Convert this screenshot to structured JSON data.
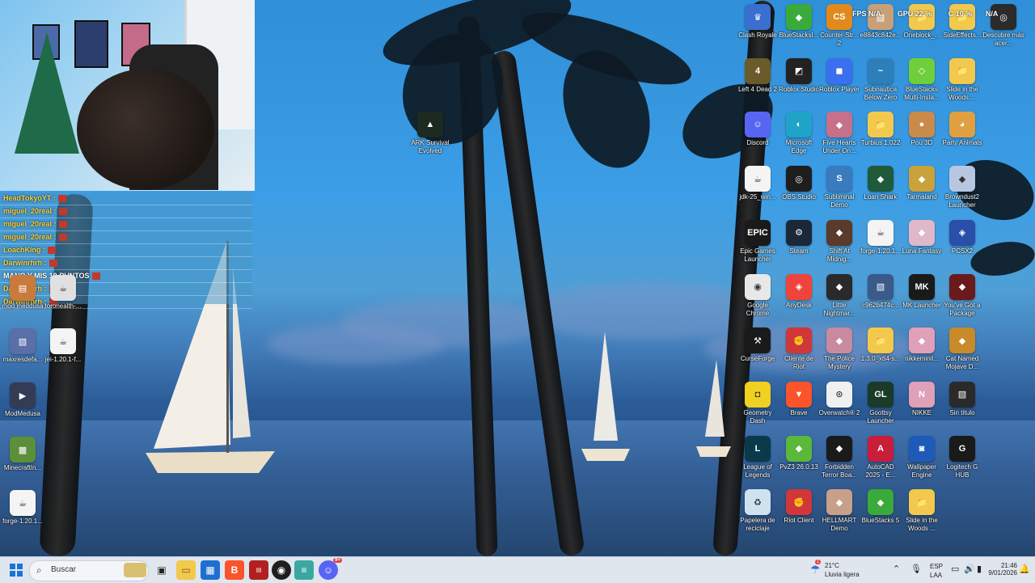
{
  "webcam_chat": {
    "lines": [
      {
        "user": "HeadTokyoYT :",
        "msg": ""
      },
      {
        "user": "miguel_20real :",
        "msg": ""
      },
      {
        "user": "miguel_20real :",
        "msg": ""
      },
      {
        "user": "miguel_20real :",
        "msg": ""
      },
      {
        "user": "LoachKing :",
        "msg": ""
      },
      {
        "user": "Darwinrhrh :",
        "msg": ""
      },
      {
        "user": "",
        "msg": "MANO Y MIS 10 PUNTOS"
      },
      {
        "user": "Darwinrhrh :",
        "msg": ""
      },
      {
        "user": "Darwinrhrh :",
        "msg": ""
      }
    ]
  },
  "desktop": {
    "left_icons": [
      {
        "label": "mod meddusa",
        "icon": "file-icon",
        "color": "#c97b3c"
      },
      {
        "label": "toronealth-...",
        "icon": "java-icon",
        "color": "#e0e0e0"
      },
      {
        "label": "maxresdefa...",
        "icon": "image-icon",
        "color": "#5a6fa8"
      },
      {
        "label": "jei-1.20.1-f...",
        "icon": "java-icon",
        "color": "#f4f4f4"
      },
      {
        "label": "ModMedusa",
        "icon": "video-icon",
        "color": "#333b55"
      },
      {
        "label": "MinecraftIn...",
        "icon": "minecraft-icon",
        "color": "#5b8f3a"
      },
      {
        "label": "forge-1.20.1...",
        "icon": "java-icon",
        "color": "#f4f4f4"
      }
    ],
    "ark_icon": {
      "label": "ARK Survival Evolved",
      "icon": "ark-icon",
      "color": "#1d2a22"
    },
    "grid": [
      [
        {
          "label": "Clash Royale",
          "icon": "clash-royale-icon",
          "color": "#3a6fd0"
        },
        {
          "label": "BlueStacksI...",
          "icon": "bluestacks-icon",
          "color": "#3aaa3a"
        },
        {
          "label": "Counter-Str... 2",
          "icon": "counter-strike-icon",
          "color": "#e08a1e"
        },
        {
          "label": "e8843c842e...",
          "icon": "image-icon",
          "color": "#c7a07a"
        },
        {
          "label": "Oneblock_...",
          "icon": "folder-icon",
          "color": "#f2c94c"
        },
        {
          "label": "SideEffects...",
          "icon": "folder-icon",
          "color": "#f2c94c"
        },
        {
          "label": "Descubre más acer...",
          "icon": "acer-icon",
          "color": "#2b2b2b"
        }
      ],
      [
        {
          "label": "Left 4 Dead 2",
          "icon": "left4dead-icon",
          "color": "#6b5b2a"
        },
        {
          "label": "Roblox Studio",
          "icon": "roblox-studio-icon",
          "color": "#222222"
        },
        {
          "label": "Roblox Player",
          "icon": "roblox-icon",
          "color": "#3a6ff0"
        },
        {
          "label": "Subnautica Below Zero",
          "icon": "subnautica-icon",
          "color": "#2c7fb8"
        },
        {
          "label": "BlueStacks Multi-Insta...",
          "icon": "bluestacks-multi-icon",
          "color": "#6fcf3a"
        },
        {
          "label": "Slide in the Woods ...",
          "icon": "folder-icon",
          "color": "#f2c94c"
        }
      ],
      [
        {
          "label": "Discord",
          "icon": "discord-icon",
          "color": "#5865f2"
        },
        {
          "label": "Microsoft Edge",
          "icon": "edge-icon",
          "color": "#1fa3c7"
        },
        {
          "label": "Five Hearts Under On...",
          "icon": "game-icon",
          "color": "#c7708a"
        },
        {
          "label": "Turbius 1.022",
          "icon": "folder-icon",
          "color": "#f2c94c"
        },
        {
          "label": "Pou 3D",
          "icon": "pou-icon",
          "color": "#c98a4a"
        },
        {
          "label": "Party Animals",
          "icon": "party-animals-icon",
          "color": "#e0a040"
        }
      ],
      [
        {
          "label": "jdk-25_win...",
          "icon": "java-icon",
          "color": "#f4f4f4"
        },
        {
          "label": "OBS Studio",
          "icon": "obs-icon",
          "color": "#1e1e1e"
        },
        {
          "label": "Subliminal Demo",
          "icon": "subliminal-icon",
          "color": "#3a7abf"
        },
        {
          "label": "Loan Shark",
          "icon": "game-icon",
          "color": "#1f5a3a"
        },
        {
          "label": "Tarmaland",
          "icon": "game-icon",
          "color": "#c9a23a"
        },
        {
          "label": "Browndust2 Launcher",
          "icon": "game-icon",
          "color": "#b8c7e0"
        }
      ],
      [
        {
          "label": "Epic Games Launcher",
          "icon": "epic-games-icon",
          "color": "#1a1a1a"
        },
        {
          "label": "Steam",
          "icon": "steam-icon",
          "color": "#1b2838"
        },
        {
          "label": "Shift At Midnig...",
          "icon": "game-icon",
          "color": "#5a3a2a"
        },
        {
          "label": "forge-1.20.1...",
          "icon": "java-icon",
          "color": "#f4f4f4"
        },
        {
          "label": "Luna Fantasy",
          "icon": "game-icon",
          "color": "#e0b8c8"
        },
        {
          "label": "PCSX2",
          "icon": "pcsx2-icon",
          "color": "#2a4fa8"
        }
      ],
      [
        {
          "label": "Google Chrome",
          "icon": "chrome-icon",
          "color": "#e8e8e8"
        },
        {
          "label": "AnyDesk",
          "icon": "anydesk-icon",
          "color": "#ef443b"
        },
        {
          "label": "Little Nightmar...",
          "icon": "game-icon",
          "color": "#2a2a2a"
        },
        {
          "label": "c962b474c...",
          "icon": "image-icon",
          "color": "#3a5a8a"
        },
        {
          "label": "MK Launcher",
          "icon": "mk-launcher-icon",
          "color": "#1a1a1a"
        },
        {
          "label": "You've Got a Package",
          "icon": "game-icon",
          "color": "#6a1a1a"
        }
      ],
      [
        {
          "label": "CurseForge",
          "icon": "curseforge-icon",
          "color": "#1a1a1a"
        },
        {
          "label": "Cliente de Riot",
          "icon": "riot-icon",
          "color": "#d13639"
        },
        {
          "label": "The Police Mystery",
          "icon": "game-icon",
          "color": "#c98aa0"
        },
        {
          "label": "1.3.0_x64-s...",
          "icon": "folder-icon",
          "color": "#f2c94c"
        },
        {
          "label": "nikkeminil...",
          "icon": "game-icon",
          "color": "#e0a0b8"
        },
        {
          "label": "Cat Named Mojave D...",
          "icon": "game-icon",
          "color": "#c98a2a"
        }
      ],
      [
        {
          "label": "Geometry Dash",
          "icon": "geometry-dash-icon",
          "color": "#f0d020"
        },
        {
          "label": "Brave",
          "icon": "brave-icon",
          "color": "#fb542b"
        },
        {
          "label": "Overwatch® 2",
          "icon": "overwatch-icon",
          "color": "#f0f0f0"
        },
        {
          "label": "Goottsy Launcher",
          "icon": "goottsy-icon",
          "color": "#1a3a2a"
        },
        {
          "label": "NIKKE",
          "icon": "nikke-icon",
          "color": "#e0a0b8"
        },
        {
          "label": "Sin título",
          "icon": "image-icon",
          "color": "#2a2a2a"
        }
      ],
      [
        {
          "label": "League of Legends",
          "icon": "league-icon",
          "color": "#0a3a4a"
        },
        {
          "label": "PvZ3 26.0.13",
          "icon": "bluestacks-icon",
          "color": "#5ab83a"
        },
        {
          "label": "Forbidden Terror Boa...",
          "icon": "game-icon",
          "color": "#1a1a1a"
        },
        {
          "label": "AutoCAD 2025 - E...",
          "icon": "autocad-icon",
          "color": "#c81e3a"
        },
        {
          "label": "Wallpaper Engine",
          "icon": "wallpaper-engine-icon",
          "color": "#1e5ab8"
        },
        {
          "label": "Logitech G HUB",
          "icon": "logitech-icon",
          "color": "#1a1a1a"
        }
      ],
      [
        {
          "label": "Papelera de reciclaje",
          "icon": "recycle-bin-icon",
          "color": "#cfe2f0"
        },
        {
          "label": "Riot Client",
          "icon": "riot-icon",
          "color": "#d13639"
        },
        {
          "label": "HELLMART Demo",
          "icon": "game-icon",
          "color": "#c8a08a"
        },
        {
          "label": "BlueStacks 5",
          "icon": "bluestacks-icon",
          "color": "#3aaa3a"
        },
        {
          "label": "Slide in the Woods ...",
          "icon": "folder-icon",
          "color": "#f2c94c"
        }
      ]
    ],
    "overlay_stats": {
      "fps_label": "FPS",
      "fps_value": "N/A",
      "gpu_label": "GPU",
      "gpu_value": "22 %",
      "cpu_label": "C",
      "cpu_value": "10 %",
      "na_value": "N/A"
    }
  },
  "taskbar": {
    "search_placeholder": "Buscar",
    "weather_temp": "21°C",
    "weather_desc": "Lluvia ligera",
    "lang_top": "ESP",
    "lang_bottom": "LAA",
    "time": "21:46",
    "date": "9/01/2026",
    "discord_badge": "9+",
    "alert_badge": "1"
  }
}
